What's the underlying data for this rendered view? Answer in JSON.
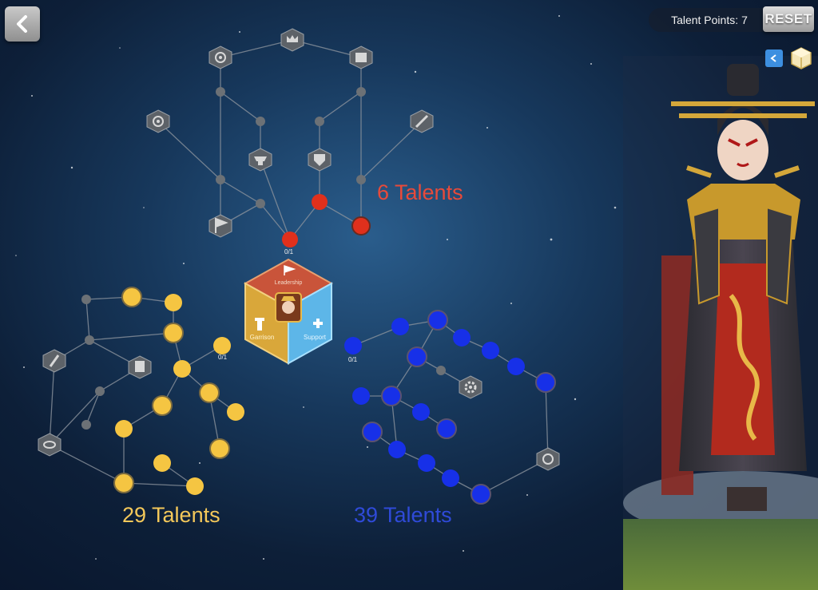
{
  "header": {
    "talent_points_label": "Talent Points:",
    "talent_points_value": "7",
    "reset_label": "RESET"
  },
  "icons": {
    "back": "chevron-left-icon",
    "collapse": "chevron-left-icon",
    "cube": "cube-icon"
  },
  "trees": {
    "leadership": {
      "label": "Leadership",
      "count": "6 Talents",
      "color": "#e84a3a",
      "counter": "0/1"
    },
    "garrison": {
      "label": "Garrison",
      "count": "29 Talents",
      "color": "#f4c85a",
      "counter": "0/1"
    },
    "support": {
      "label": "Support",
      "count": "39 Talents",
      "color": "#2f4ad8",
      "counter": "0/1"
    }
  },
  "colors": {
    "inactive_node": "#6c7176",
    "leadership_segment": "#c9543a",
    "garrison_segment": "#d9a73a",
    "support_segment": "#5db6e8"
  }
}
